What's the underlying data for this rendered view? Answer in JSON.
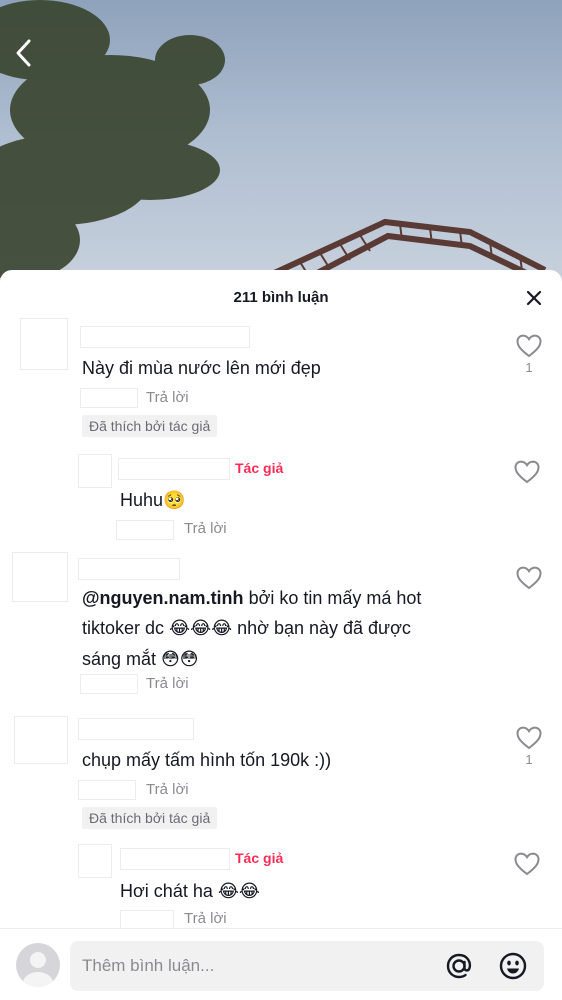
{
  "header": {
    "title": "211 bình luận"
  },
  "comments": [
    {
      "text": "Này đi mùa nước lên mới đẹp",
      "reply_label": "Trả lời",
      "liked_badge": "Đã thích bởi tác giả",
      "like_count": "1"
    },
    {
      "text": "Huhu",
      "emoji": "🥺",
      "reply_label": "Trả lời",
      "author_tag": "Tác giả"
    },
    {
      "mention": "@nguyen.nam.tinh",
      "line1": " bởi ko tin mấy má hot",
      "line2a": "tiktoker dc ",
      "emoji2": "😂😂😂",
      "line2b": " nhờ bạn này đã được",
      "line3": "sáng mắt ",
      "emoji3": "😳😳",
      "reply_label": "Trả lời"
    },
    {
      "text": "chụp mấy tấm hình tốn 190k :))",
      "reply_label": "Trả lời",
      "liked_badge": "Đã thích bởi tác giả",
      "like_count": "1"
    },
    {
      "text": "Hơi chát ha ",
      "emoji": "😂😂",
      "reply_label": "Trả lời",
      "author_tag": "Tác giả"
    }
  ],
  "input": {
    "placeholder": "Thêm bình luận..."
  },
  "icons": {
    "back": "chevron-left-icon",
    "close": "close-icon",
    "like": "heart-outline-icon",
    "mention": "at-sign-icon",
    "emoji": "smiley-icon"
  },
  "colors": {
    "accent": "#fe2c55",
    "text": "#161823",
    "muted": "#8a8b91"
  }
}
